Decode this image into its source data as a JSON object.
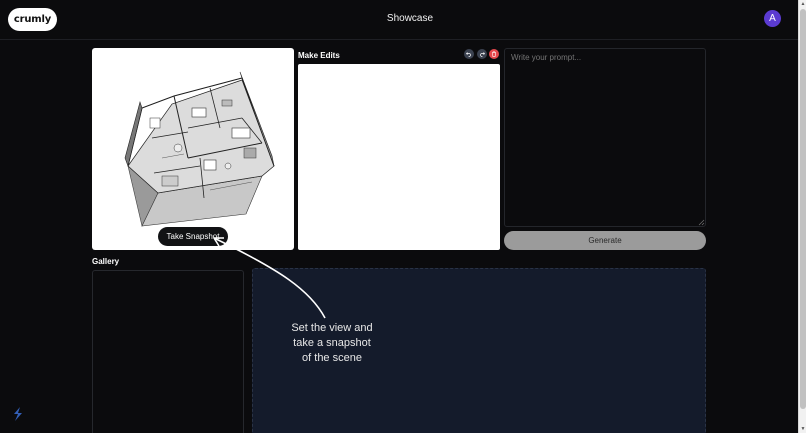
{
  "header": {
    "logo_text": "crumly",
    "title": "Showcase",
    "avatar_initial": "A"
  },
  "viewer": {
    "snapshot_button": "Take Snapshot"
  },
  "edits": {
    "label": "Make Edits",
    "undo_icon": "undo-icon",
    "redo_icon": "redo-icon",
    "delete_icon": "trash-icon"
  },
  "prompt": {
    "placeholder": "Write your prompt...",
    "value": ""
  },
  "generate": {
    "label": "Generate"
  },
  "gallery": {
    "heading": "Gallery",
    "hint_lines": [
      "Set the view and",
      "take a snapshot",
      "of the scene"
    ]
  },
  "colors": {
    "background": "#0b0b0d",
    "avatar": "#5b3bd1",
    "delete": "#e5484d",
    "dropzone": "#141b2b",
    "generate_disabled": "#9b9b9b"
  }
}
